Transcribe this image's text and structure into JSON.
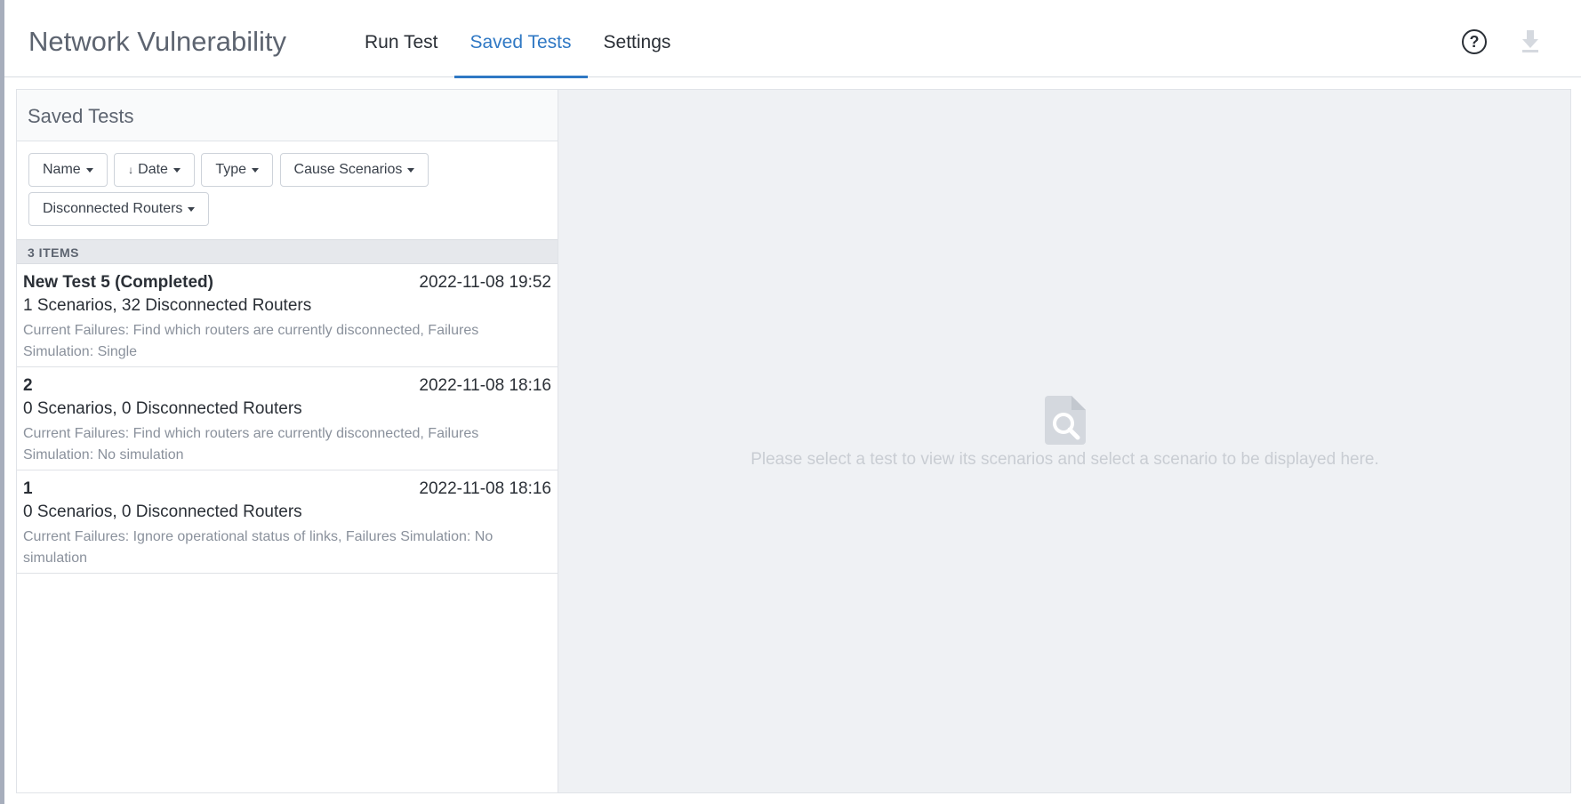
{
  "header": {
    "app_title": "Network Vulnerability",
    "tabs": [
      {
        "label": "Run Test",
        "active": false
      },
      {
        "label": "Saved Tests",
        "active": true
      },
      {
        "label": "Settings",
        "active": false
      }
    ],
    "help_label": "?",
    "icons": {
      "help": "help-circle-icon",
      "download": "download-icon"
    }
  },
  "list": {
    "title": "Saved Tests",
    "filters": [
      {
        "label": "Name"
      },
      {
        "label": "Date",
        "sort": "descending"
      },
      {
        "label": "Type"
      },
      {
        "label": "Cause Scenarios"
      },
      {
        "label": "Disconnected Routers"
      }
    ],
    "count_label": "3 ITEMS",
    "items": [
      {
        "name": "New Test 5 (Completed)",
        "date": "2022-11-08 19:52",
        "summary": "1 Scenarios, 32 Disconnected Routers",
        "description": "Current Failures: Find which routers are currently disconnected, Failures Simulation: Single"
      },
      {
        "name": "2",
        "date": "2022-11-08 18:16",
        "summary": "0 Scenarios, 0 Disconnected Routers",
        "description": "Current Failures: Find which routers are currently disconnected, Failures Simulation: No simulation"
      },
      {
        "name": "1",
        "date": "2022-11-08 18:16",
        "summary": "0 Scenarios, 0 Disconnected Routers",
        "description": "Current Failures: Ignore operational status of links, Failures Simulation: No simulation"
      }
    ]
  },
  "detail": {
    "empty_message": "Please select a test to view its scenarios and select a scenario to be displayed here.",
    "icon": "document-search-icon"
  },
  "colors": {
    "accent": "#2f78c4",
    "status_pill": "#7cbb4a",
    "muted_text": "#8a919c",
    "detail_background": "#eff1f4"
  }
}
